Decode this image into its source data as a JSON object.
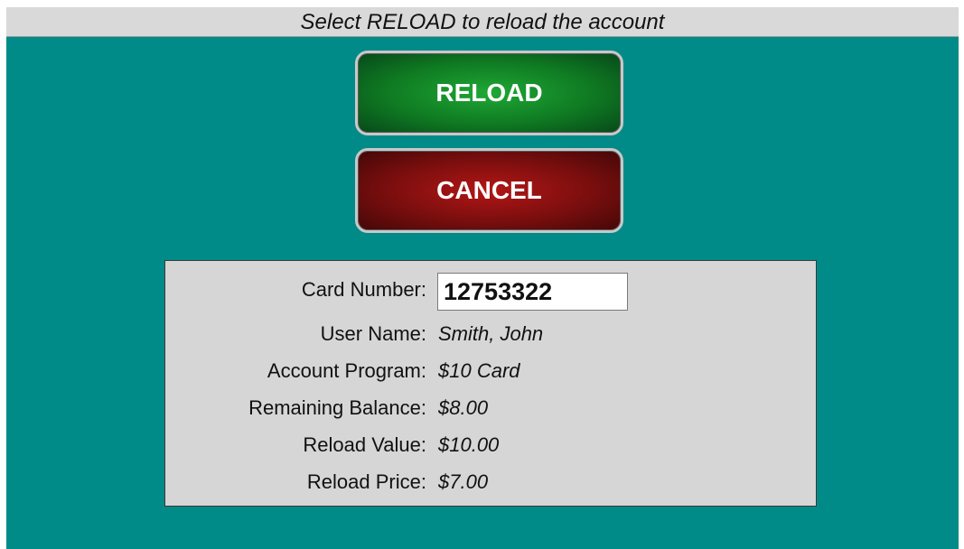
{
  "instruction": "Select RELOAD to reload the account",
  "buttons": {
    "reload_label": "RELOAD",
    "cancel_label": "CANCEL"
  },
  "account": {
    "card_number_label": "Card Number:",
    "card_number_value": "12753322",
    "user_name_label": "User Name:",
    "user_name_value": "Smith, John",
    "account_program_label": "Account Program:",
    "account_program_value": "$10 Card",
    "remaining_balance_label": "Remaining Balance:",
    "remaining_balance_value": "$8.00",
    "reload_value_label": "Reload Value:",
    "reload_value_value": "$10.00",
    "reload_price_label": "Reload Price:",
    "reload_price_value": "$7.00"
  },
  "colors": {
    "background": "#008b89",
    "instruction_bar": "#d9d9d9",
    "reload_button": "#0f7a22",
    "cancel_button": "#7a0e0e",
    "panel": "#d6d6d6"
  }
}
